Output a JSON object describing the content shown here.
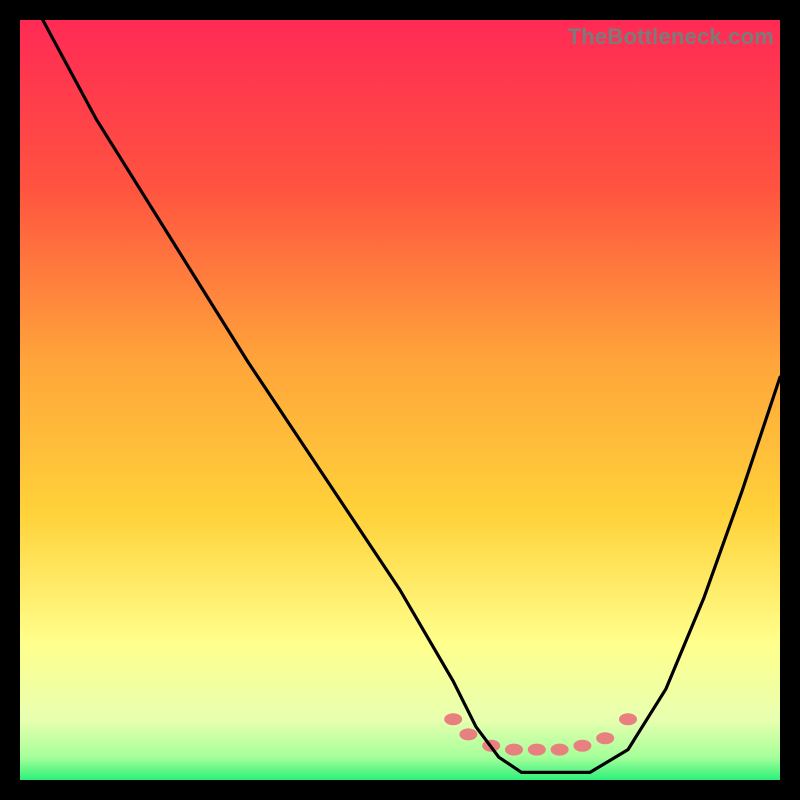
{
  "watermark": "TheBottleneck.com",
  "chart_data": {
    "type": "line",
    "title": "",
    "xlabel": "",
    "ylabel": "",
    "xlim": [
      0,
      100
    ],
    "ylim": [
      0,
      100
    ],
    "grid": false,
    "legend": false,
    "background_gradient": {
      "top_color": "#ff2a55",
      "mid_color": "#ffd23a",
      "lower_color": "#ffff8c",
      "bottom_color": "#2df07a"
    },
    "series": [
      {
        "name": "bottleneck-curve",
        "x": [
          3,
          10,
          20,
          30,
          40,
          50,
          57,
          60,
          63,
          66,
          70,
          75,
          80,
          85,
          90,
          95,
          100
        ],
        "values": [
          100,
          87,
          71,
          55,
          40,
          25,
          13,
          7,
          3,
          1,
          1,
          1,
          4,
          12,
          24,
          38,
          53
        ]
      }
    ],
    "floor_markers": {
      "name": "optimal-range",
      "x": [
        57,
        59,
        62,
        65,
        68,
        71,
        74,
        77,
        80
      ],
      "y": [
        8,
        6,
        4.5,
        4,
        4,
        4,
        4.5,
        5.5,
        8
      ],
      "color": "#e98080"
    }
  }
}
